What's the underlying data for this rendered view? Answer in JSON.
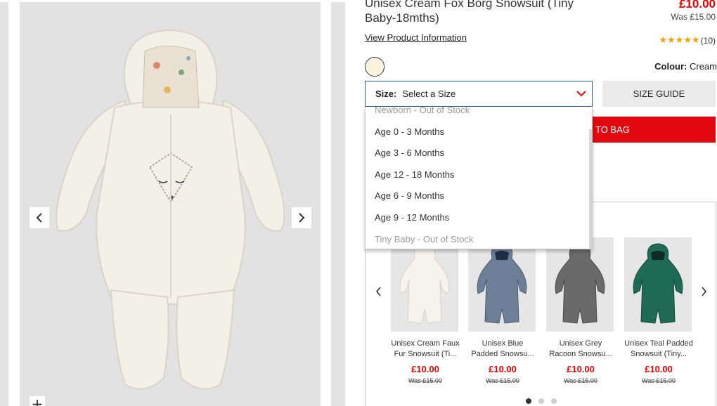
{
  "product": {
    "title": "Unisex Cream Fox Borg Snowsuit (Tiny Baby-18mths)",
    "price": "£10.00",
    "was_price": "Was £15.00",
    "view_info_link": "View Product Information",
    "stars": "★★★★★",
    "review_count": "(10)",
    "rating": 5,
    "colour_label": "Colour:",
    "colour_value": "Cream"
  },
  "size_select": {
    "label": "Size:",
    "value": "Select a Size",
    "options": [
      {
        "text": "Newborn - Out of Stock",
        "enabled": false
      },
      {
        "text": "Age 0 - 3 Months",
        "enabled": true
      },
      {
        "text": "Age 3 - 6 Months",
        "enabled": true
      },
      {
        "text": "Age 12 - 18 Months",
        "enabled": true
      },
      {
        "text": "Age 6 - 9 Months",
        "enabled": true
      },
      {
        "text": "Age 9 - 12 Months",
        "enabled": true
      },
      {
        "text": "Tiny Baby - Out of Stock",
        "enabled": false
      }
    ]
  },
  "buttons": {
    "size_guide": "SIZE GUIDE",
    "add_to_bag": "TO BAG",
    "zoom": "+"
  },
  "recommendations": {
    "items": [
      {
        "name": "Unisex Cream Faux Fur Snowsuit (Ti...",
        "price": "£10.00",
        "was": "Was £15.00"
      },
      {
        "name": "Unisex Blue Padded Snowsu...",
        "price": "£10.00",
        "was": "Was £15.00"
      },
      {
        "name": "Unisex Grey Racoon Snowsu...",
        "price": "£10.00",
        "was": "Was £15.00"
      },
      {
        "name": "Unisex Teal Padded Snowsuit (Tiny...",
        "price": "£10.00",
        "was": "Was £15.00"
      }
    ],
    "pagination_pages": 3,
    "active_page": 1
  },
  "colors": {
    "accent_red": "#e1090f",
    "price_red": "#ee0000",
    "star_gold": "#f1a10a",
    "select_border": "#2b5fb4",
    "swatch_cream": "#fbf3dc"
  },
  "icons": {
    "gallery_prev": "chevron-left-icon",
    "gallery_next": "chevron-right-icon",
    "select_chevron": "chevron-down-icon",
    "zoom": "plus-icon"
  }
}
